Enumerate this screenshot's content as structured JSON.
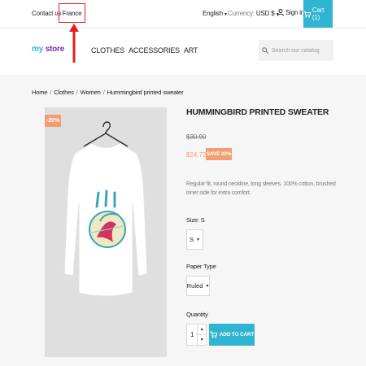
{
  "topnav": {
    "contact_label": "Contact us",
    "country_label": "France",
    "language_label": "English",
    "currency_prefix": "Currency:",
    "currency_value": "USD $",
    "signin_label": "Sign in",
    "cart_label": "Cart (1)"
  },
  "header": {
    "logo_part1": "my",
    "logo_part2": "store",
    "menu": [
      "CLOTHES",
      "ACCESSORIES",
      "ART"
    ],
    "search_placeholder": "Search our catalog"
  },
  "breadcrumb": {
    "items": [
      "Home",
      "Clothes",
      "Women",
      "Hummingbird printed sweater"
    ],
    "separator": "/"
  },
  "product": {
    "discount_badge": "-20%",
    "title": "HUMMINGBIRD PRINTED SWEATER",
    "old_price": "$30.90",
    "new_price": "$24.72",
    "save_badge": "SAVE 20%",
    "description": "Regular fit, round neckline, long sleeves. 100% cotton, brushed inner side for extra comfort.",
    "size_label": "Size: S",
    "size_value": "S",
    "paper_label": "Paper Type",
    "paper_value": "Ruled",
    "quantity_label": "Quantity",
    "quantity_value": "1",
    "add_to_cart_label": "ADD TO CART"
  },
  "colors": {
    "accent": "#2fb5d2",
    "discount": "#f39d72",
    "annotation": "#e01f1f"
  }
}
